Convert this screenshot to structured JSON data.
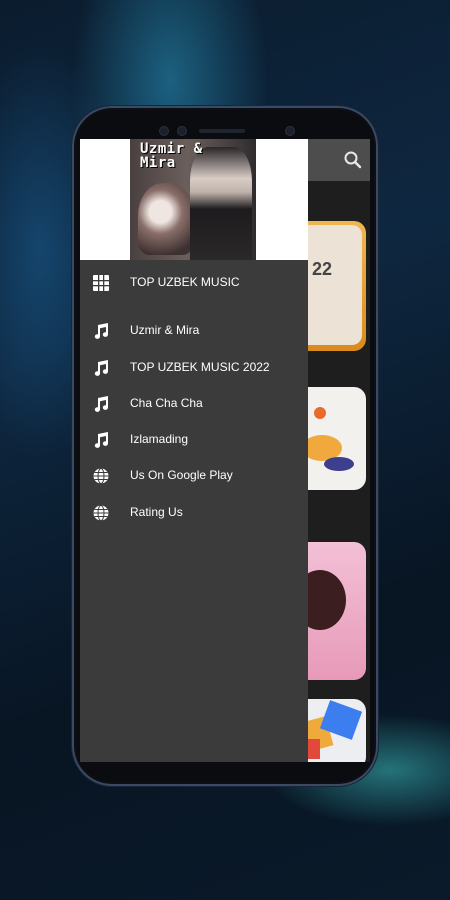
{
  "album": {
    "caption": "Uzmir &\nMira"
  },
  "drawer": {
    "items": [
      {
        "label": "TOP UZBEK MUSIC",
        "icon": "grid-icon"
      },
      {
        "label": "Uzmir & Mira",
        "icon": "music-note-icon"
      },
      {
        "label": "TOP UZBEK MUSIC 2022",
        "icon": "music-note-icon"
      },
      {
        "label": "Cha Cha Cha",
        "icon": "music-note-icon"
      },
      {
        "label": "Izlamading",
        "icon": "music-note-icon"
      },
      {
        "label": "Us On Google Play",
        "icon": "globe-icon"
      },
      {
        "label": "Rating Us",
        "icon": "globe-icon"
      }
    ]
  },
  "background_card": {
    "text": "22"
  },
  "colors": {
    "drawer_bg": "#3b3b3b",
    "header_bg": "#ffffff",
    "toolbar_bg": "#4d4d4d",
    "text": "#ffffff"
  }
}
